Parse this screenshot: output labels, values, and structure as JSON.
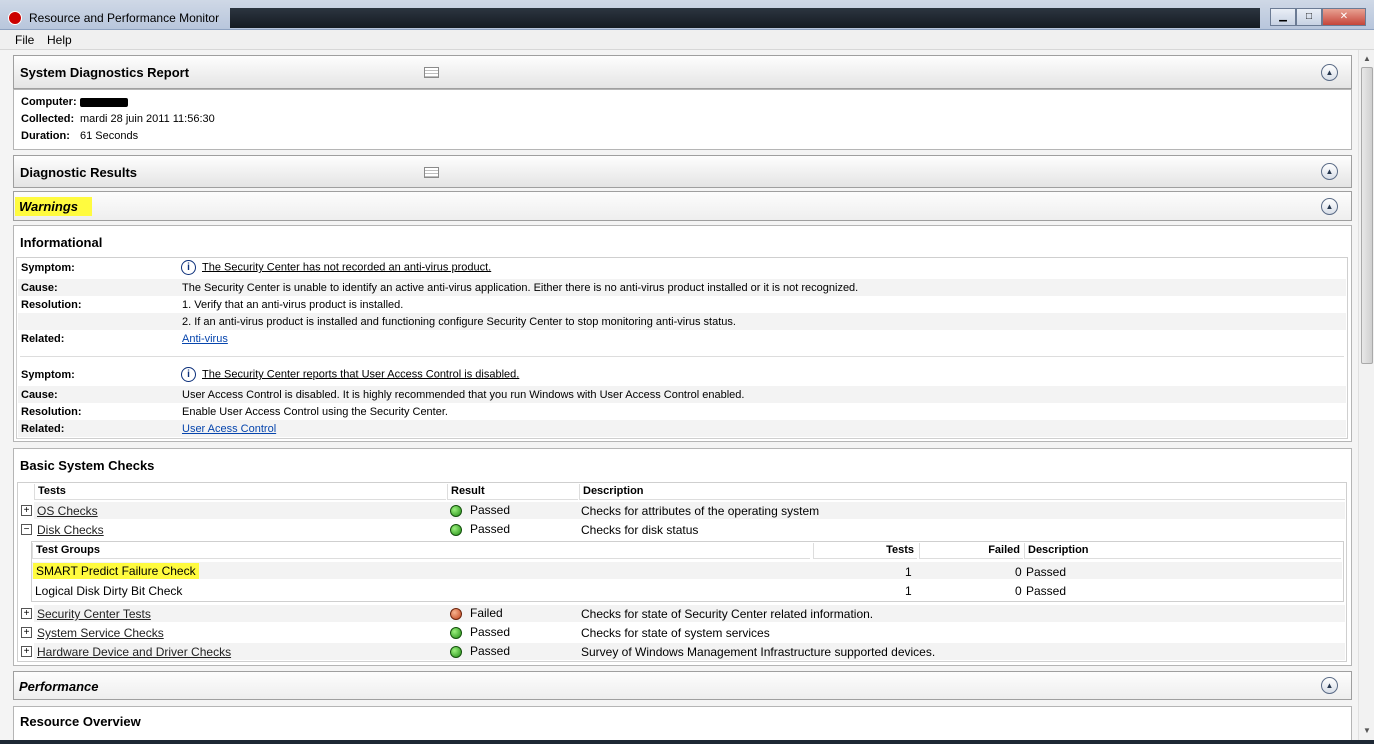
{
  "window": {
    "title": "Resource and Performance Monitor",
    "minimize": "▁",
    "maximize": "□",
    "close": "✕"
  },
  "menu": {
    "file": "File",
    "help": "Help"
  },
  "report": {
    "title": "System Diagnostics Report",
    "computer_label": "Computer:",
    "collected_label": "Collected:",
    "collected_value": "mardi 28 juin 2011 11:56:30",
    "duration_label": "Duration:",
    "duration_value": "61 Seconds"
  },
  "diagnostic": {
    "title": "Diagnostic Results"
  },
  "warnings": {
    "title": "Warnings"
  },
  "informational": {
    "title": "Informational",
    "labels": {
      "symptom": "Symptom:",
      "cause": "Cause:",
      "resolution": "Resolution:",
      "related": "Related:"
    },
    "items": [
      {
        "symptom": "The Security Center has not recorded an anti-virus product.",
        "cause": "The Security Center is unable to identify an active anti-virus application. Either there is no anti-virus product installed or it is not recognized.",
        "resolution1": "1. Verify that an anti-virus product is installed.",
        "resolution2": "2. If an anti-virus product is installed and functioning configure Security Center to stop monitoring anti-virus status.",
        "related": "Anti-virus"
      },
      {
        "symptom": "The Security Center reports that User Access Control is disabled.",
        "cause": "User Access Control is disabled. It is highly recommended that you run Windows with User Access Control enabled.",
        "resolution1": "Enable User Access Control using the Security Center.",
        "related": "User Acess Control"
      }
    ]
  },
  "basic_checks": {
    "title": "Basic System Checks",
    "columns": {
      "tests": "Tests",
      "result": "Result",
      "description": "Description"
    },
    "rows": [
      {
        "name": "OS Checks",
        "expander": "+",
        "status": "ok",
        "result": "Passed",
        "description": "Checks for attributes of the operating system"
      },
      {
        "name": "Disk Checks",
        "expander": "−",
        "status": "ok",
        "result": "Passed",
        "description": "Checks for disk status"
      },
      {
        "name": "Security Center Tests",
        "expander": "+",
        "status": "failed",
        "result": "Failed",
        "description": "Checks for state of Security Center related information."
      },
      {
        "name": "System Service Checks",
        "expander": "+",
        "status": "ok",
        "result": "Passed",
        "description": "Checks for state of system services"
      },
      {
        "name": "Hardware Device and Driver Checks",
        "expander": "+",
        "status": "ok",
        "result": "Passed",
        "description": "Survey of Windows Management Infrastructure supported devices."
      }
    ],
    "subtable": {
      "columns": {
        "groups": "Test Groups",
        "tests": "Tests",
        "failed": "Failed",
        "description": "Description"
      },
      "rows": [
        {
          "group": "SMART Predict Failure Check",
          "tests": "1",
          "failed": "0",
          "description": "Passed",
          "highlighted": true
        },
        {
          "group": "Logical Disk Dirty Bit Check",
          "tests": "1",
          "failed": "0",
          "description": "Passed",
          "highlighted": false
        }
      ]
    }
  },
  "performance": {
    "title": "Performance"
  },
  "resource_overview": {
    "title": "Resource Overview"
  },
  "colors": {
    "highlight": "#fffb3f",
    "link": "#0645ad",
    "passed": "#1f8c12",
    "failed": "#c2421a"
  },
  "icons": {
    "collapse": "chevron-up-icon",
    "info": "info-icon",
    "grid": "grid-view-icon"
  }
}
